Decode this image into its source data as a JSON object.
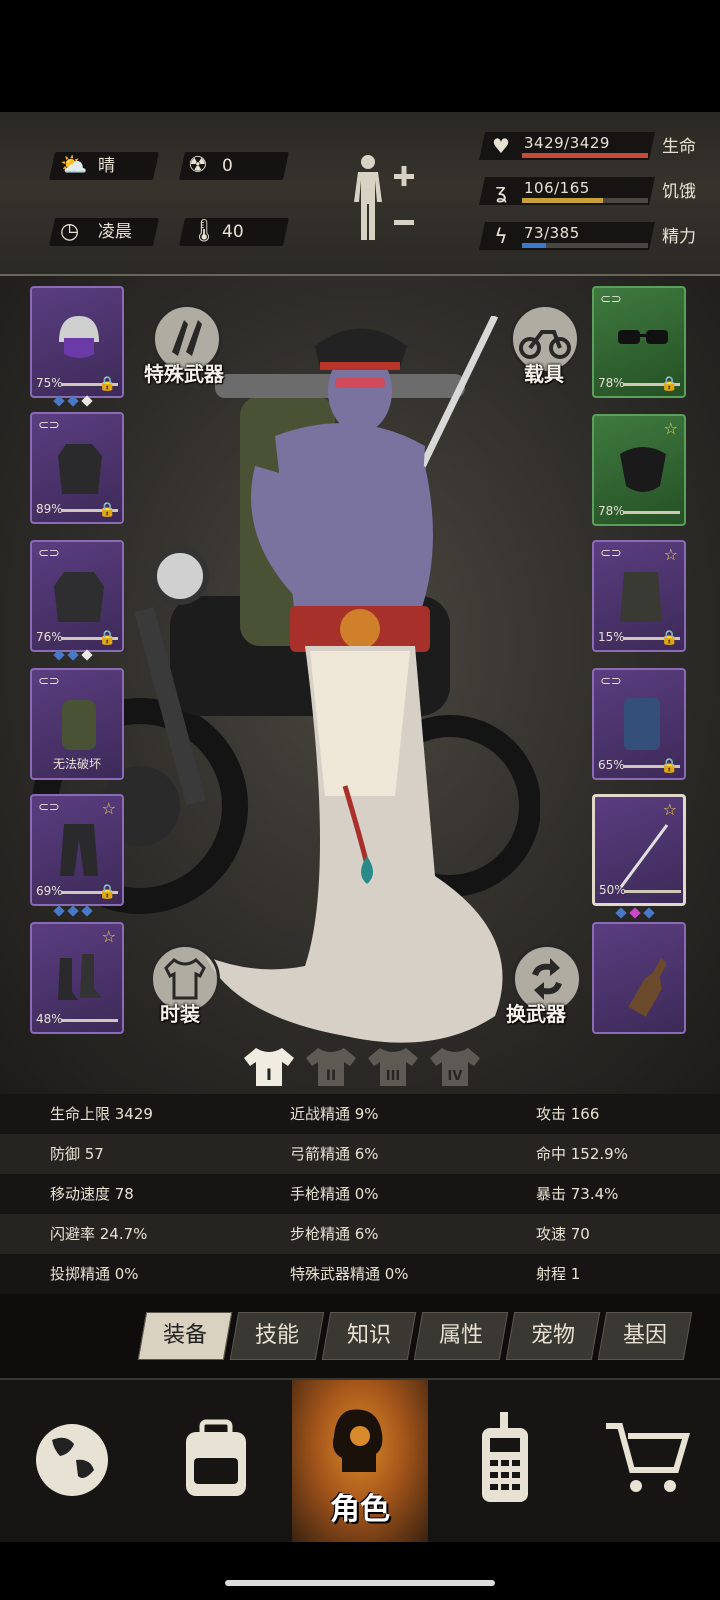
{
  "weather": {
    "condition": "晴",
    "radiation": "0",
    "time_of_day": "凌晨",
    "temperature": "40"
  },
  "vitals": [
    {
      "icon": "heart-icon",
      "value": "3429/3429",
      "label": "生命",
      "fill": 1.0,
      "color": "#c84a3a"
    },
    {
      "icon": "stomach-icon",
      "value": "106/165",
      "label": "饥饿",
      "fill": 0.64,
      "color": "#c8a03a"
    },
    {
      "icon": "energy-icon",
      "value": "73/385",
      "label": "精力",
      "fill": 0.19,
      "color": "#3a7ac8"
    }
  ],
  "equipment_left": [
    {
      "name": "helmet",
      "percent": "75%",
      "star": false,
      "gems": [
        "#4a78c8",
        "#4a78c8",
        "#e8e8e8"
      ]
    },
    {
      "name": "jacket",
      "percent": "89%",
      "star": false,
      "gems": []
    },
    {
      "name": "coat",
      "percent": "76%",
      "star": false,
      "gems": [
        "#4a78c8",
        "#4a78c8",
        "#e8e8e8"
      ]
    },
    {
      "name": "backpack",
      "note": "无法破坏",
      "star": false,
      "gems": []
    },
    {
      "name": "pants",
      "percent": "69%",
      "star": true,
      "gems": [
        "#4a78c8",
        "#4a78c8",
        "#4a78c8"
      ]
    },
    {
      "name": "boots",
      "percent": "48%",
      "star": true,
      "gems": []
    }
  ],
  "equipment_right": [
    {
      "name": "sunglasses",
      "percent": "78%",
      "star": false,
      "green": true
    },
    {
      "name": "mask",
      "percent": "78%",
      "star": true,
      "green": true
    },
    {
      "name": "vest",
      "percent": "15%",
      "star": true,
      "green": false
    },
    {
      "name": "shield",
      "percent": "65%",
      "star": false,
      "green": false
    },
    {
      "name": "katana",
      "percent": "50%",
      "star": true,
      "green": false,
      "gems": [
        "#4a78c8",
        "#c848c8",
        "#4a78c8"
      ]
    },
    {
      "name": "molotov",
      "star": false,
      "green": false
    }
  ],
  "actions": {
    "special_weapon": "特殊武器",
    "vehicle": "载具",
    "fashion": "时装",
    "swap_weapon": "换武器"
  },
  "loadout_tabs": [
    "I",
    "II",
    "III",
    "IV"
  ],
  "stats": [
    [
      "生命上限 3429",
      "近战精通 9%",
      "攻击 166"
    ],
    [
      "防御 57",
      "弓箭精通 6%",
      "命中 152.9%"
    ],
    [
      "移动速度 78",
      "手枪精通 0%",
      "暴击 73.4%"
    ],
    [
      "闪避率 24.7%",
      "步枪精通 6%",
      "攻速 70"
    ],
    [
      "投掷精通 0%",
      "特殊武器精通 0%",
      "射程 1"
    ]
  ],
  "sub_tabs": [
    "装备",
    "技能",
    "知识",
    "属性",
    "宠物",
    "基因"
  ],
  "bottom_nav": {
    "active_label": "角色",
    "items": [
      "globe-icon",
      "backpack-icon",
      "character-icon",
      "radio-icon",
      "cart-icon"
    ]
  }
}
